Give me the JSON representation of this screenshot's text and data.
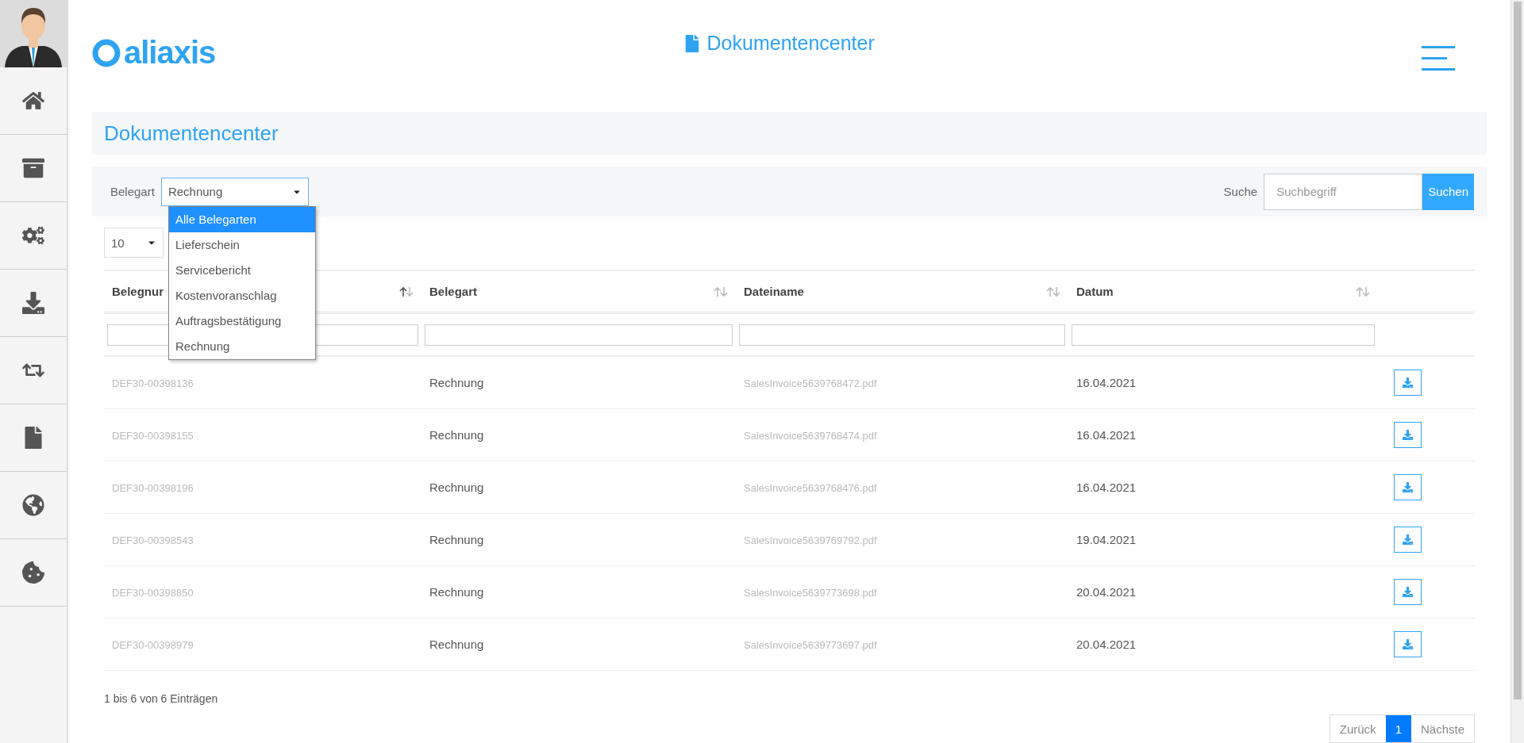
{
  "header": {
    "logo": "aliaxis",
    "title": "Dokumentencenter"
  },
  "page_title": "Dokumentencenter",
  "filter": {
    "label": "Belegart",
    "value": "Rechnung",
    "expanded": true,
    "options": [
      {
        "label": "Alle Belegarten",
        "highlighted": true
      },
      {
        "label": "Lieferschein",
        "highlighted": false
      },
      {
        "label": "Servicebericht",
        "highlighted": false
      },
      {
        "label": "Kostenvoranschlag",
        "highlighted": false
      },
      {
        "label": "Auftragsbestätigung",
        "highlighted": false
      },
      {
        "label": "Rechnung",
        "highlighted": false
      }
    ]
  },
  "search": {
    "label": "Suche",
    "placeholder": "Suchbegriff",
    "button": "Suchen"
  },
  "page_length": "10",
  "table": {
    "columns": [
      {
        "label": "Belegnur",
        "sorted_ascending": true,
        "blurred": true
      },
      {
        "label": "Belegart",
        "sorted_ascending": false,
        "blurred": false
      },
      {
        "label": "Dateiname",
        "sorted_ascending": false,
        "blurred": true
      },
      {
        "label": "Datum",
        "sorted_ascending": false,
        "blurred": false
      }
    ],
    "rows": [
      [
        "DEF30-00398136",
        "Rechnung",
        "SalesInvoice5639768472.pdf",
        "16.04.2021"
      ],
      [
        "DEF30-00398155",
        "Rechnung",
        "SalesInvoice5639768474.pdf",
        "16.04.2021"
      ],
      [
        "DEF30-00398196",
        "Rechnung",
        "SalesInvoice5639768476.pdf",
        "16.04.2021"
      ],
      [
        "DEF30-00398543",
        "Rechnung",
        "SalesInvoice5639769792.pdf",
        "19.04.2021"
      ],
      [
        "DEF30-00398850",
        "Rechnung",
        "SalesInvoice5639773698.pdf",
        "20.04.2021"
      ],
      [
        "DEF30-00398979",
        "Rechnung",
        "SalesInvoice5639773697.pdf",
        "20.04.2021"
      ]
    ]
  },
  "info": "1 bis 6 von 6 Einträgen",
  "pagination": [
    {
      "label": "Zurück",
      "selected": false
    },
    {
      "label": "1",
      "selected": true
    },
    {
      "label": "Nächste",
      "selected": false
    }
  ]
}
